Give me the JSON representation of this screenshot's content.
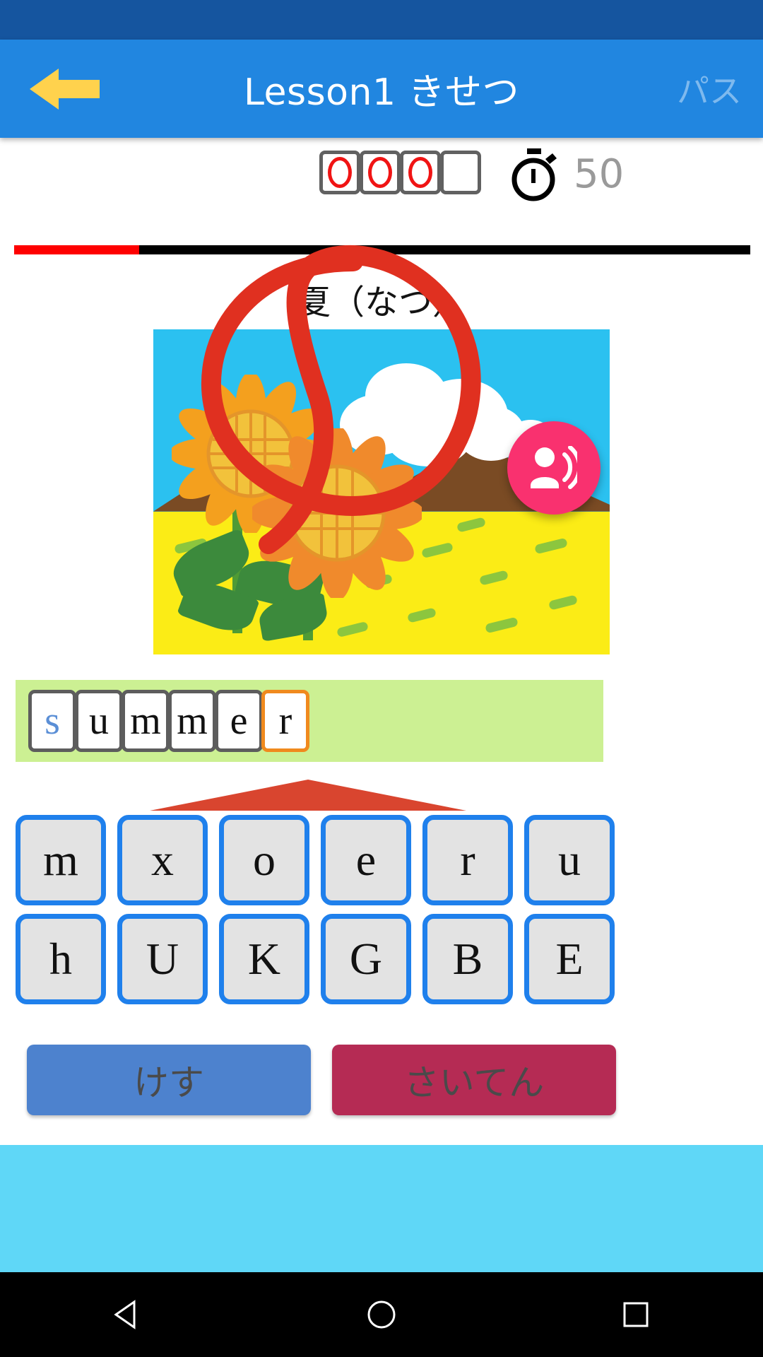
{
  "appbar": {
    "back_icon": "arrow-left-icon",
    "title": "Lesson1 きせつ",
    "pass_label": "パス"
  },
  "status": {
    "score_boxes": [
      {
        "filled": true
      },
      {
        "filled": true
      },
      {
        "filled": true
      },
      {
        "filled": false
      }
    ],
    "timer_icon": "stopwatch-icon",
    "timer_value": "50",
    "progress_percent": 17
  },
  "question": {
    "word": "夏（なつ）",
    "illustration": "summer-sunflowers-illustration",
    "marked_correct": true,
    "speak_button_icon": "record-voice-over-icon"
  },
  "answer": {
    "letters": [
      {
        "char": "s",
        "state": "hint"
      },
      {
        "char": "u",
        "state": "filled"
      },
      {
        "char": "m",
        "state": "filled"
      },
      {
        "char": "m",
        "state": "filled"
      },
      {
        "char": "e",
        "state": "filled"
      },
      {
        "char": "r",
        "state": "active"
      }
    ]
  },
  "keypad": {
    "rows": [
      [
        "m",
        "x",
        "o",
        "e",
        "r",
        "u"
      ],
      [
        "h",
        "U",
        "K",
        "G",
        "B",
        "E"
      ]
    ]
  },
  "actions": {
    "erase_label": "けす",
    "grade_label": "さいてん"
  },
  "navbar": {
    "back_icon": "triangle-back-icon",
    "home_icon": "circle-home-icon",
    "recents_icon": "square-recents-icon"
  },
  "colors": {
    "appbar": "#2186e0",
    "statusbar": "#15559f",
    "accent_pink": "#f9316f",
    "answer_strip": "#ccf093",
    "key_border": "#1f80ec",
    "erase_button": "#4d82ce",
    "grade_button": "#b52b54",
    "progress_fill": "#fe0000",
    "mark_red": "#e03020",
    "cyan_band": "#5fd7f7"
  }
}
